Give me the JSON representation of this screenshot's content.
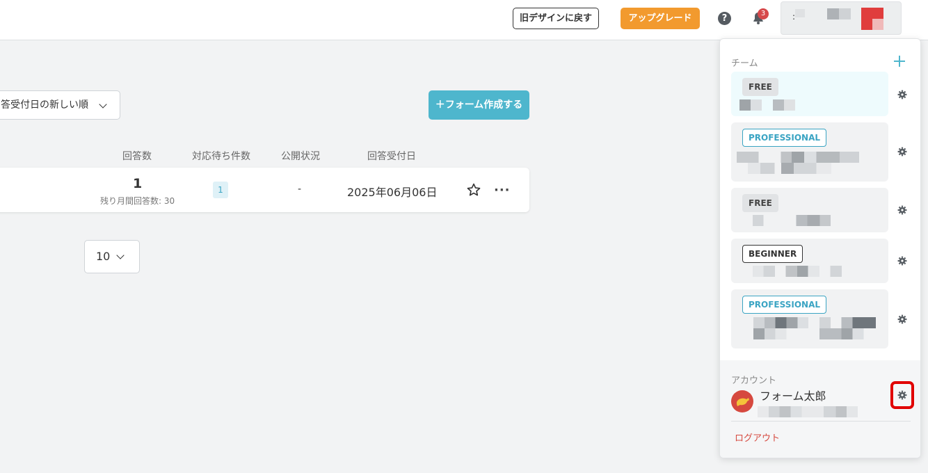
{
  "header": {
    "old_design_label": "旧デザインに戻す",
    "upgrade_label": "アップグレード",
    "help_glyph": "?",
    "notification_count": "3",
    "account_colon": ":"
  },
  "toolbar": {
    "sort_value": "答受付日の新しい順",
    "create_label": "＋フォーム作成する"
  },
  "table": {
    "columns": [
      "回答数",
      "対応待ち件数",
      "公開状況",
      "回答受付日"
    ],
    "row": {
      "responses": "1",
      "remaining": "残り月間回答数: 30",
      "pending": "1",
      "status": "-",
      "date": "2025年06月06日",
      "more": "···"
    }
  },
  "pagination": {
    "per_page": "10"
  },
  "dropdown": {
    "team_label": "チーム",
    "teams": [
      {
        "plan": "FREE",
        "active": true
      },
      {
        "plan": "PROFESSIONAL",
        "active": false
      },
      {
        "plan": "FREE",
        "active": false
      },
      {
        "plan": "BEGINNER",
        "active": false
      },
      {
        "plan": "PROFESSIONAL",
        "active": false
      }
    ],
    "account_label": "アカウント",
    "account_name": "フォーム太郎",
    "logout_label": "ログアウト"
  },
  "colors": {
    "accent": "#4eb6cd",
    "upgrade": "#f29a2e",
    "logout": "#d6493f",
    "highlight": "#e10000"
  }
}
